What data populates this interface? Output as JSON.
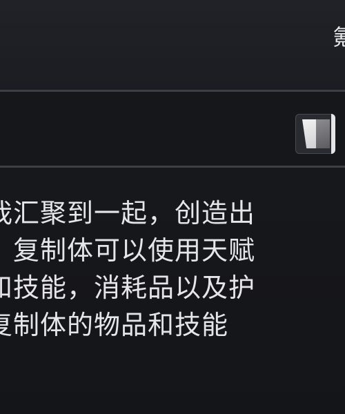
{
  "header": {
    "title_fragment": "氪"
  },
  "item": {
    "icon": "item-slot-icon"
  },
  "description": {
    "lines": [
      "我汇聚到一起，创造出",
      "。复制体可以使用天赋",
      "和技能，消耗品以及护",
      "复制体的物品和技能"
    ]
  }
}
